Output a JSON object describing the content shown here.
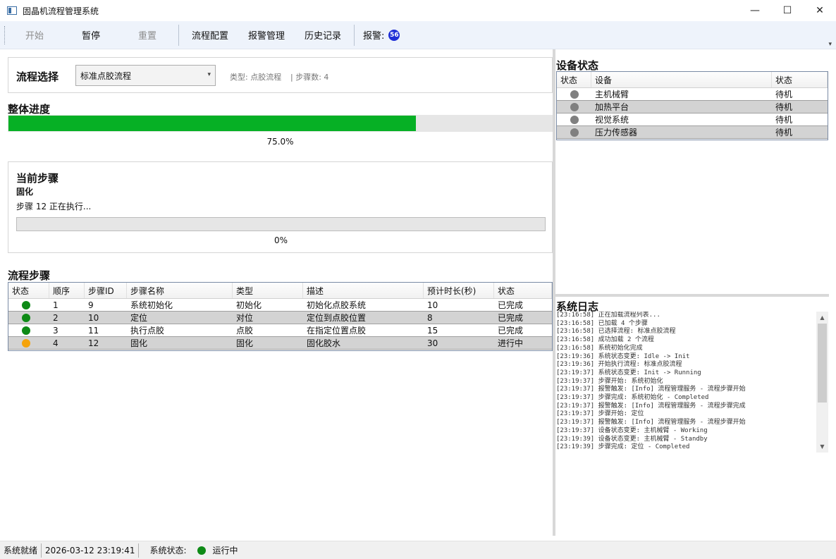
{
  "window": {
    "title": "固晶机流程管理系统",
    "controls": {
      "minimize": "—",
      "maximize": "☐",
      "close": "✕"
    }
  },
  "toolbar": {
    "start_label": "开始",
    "pause_label": "暂停",
    "reset_label": "重置",
    "config_label": "流程配置",
    "alarm_mgmt_label": "报警管理",
    "history_label": "历史记录",
    "alarm_label": "报警:",
    "alarm_count": "56",
    "overflow": "▾"
  },
  "flow_select": {
    "title": "流程选择",
    "selected": "标准点胶流程",
    "type_text": "类型: 点胶流程",
    "steps_text": "| 步骤数: 4"
  },
  "overall": {
    "title": "整体进度",
    "progress_percent": 75.0,
    "progress_text": "75.0%"
  },
  "current_step": {
    "title": "当前步骤",
    "name": "固化",
    "status": "步骤 12 正在执行...",
    "progress_percent": 0,
    "progress_text": "0%"
  },
  "flow_steps": {
    "title": "流程步骤",
    "headers": [
      "状态",
      "顺序",
      "步骤ID",
      "步骤名称",
      "类型",
      "描述",
      "预计时长(秒)",
      "状态"
    ],
    "rows": [
      {
        "order": "1",
        "id": "9",
        "name": "系统初始化",
        "type": "初始化",
        "desc": "初始化点胶系统",
        "duration": "10",
        "status": "已完成",
        "color": "#0e8a16"
      },
      {
        "order": "2",
        "id": "10",
        "name": "定位",
        "type": "对位",
        "desc": "定位到点胶位置",
        "duration": "8",
        "status": "已完成",
        "color": "#0e8a16"
      },
      {
        "order": "3",
        "id": "11",
        "name": "执行点胶",
        "type": "点胶",
        "desc": "在指定位置点胶",
        "duration": "15",
        "status": "已完成",
        "color": "#0e8a16"
      },
      {
        "order": "4",
        "id": "12",
        "name": "固化",
        "type": "固化",
        "desc": "固化胶水",
        "duration": "30",
        "status": "进行中",
        "color": "#f5a30a"
      }
    ]
  },
  "devices": {
    "title": "设备状态",
    "headers": [
      "状态",
      "设备",
      "状态"
    ],
    "rows": [
      {
        "name": "主机械臂",
        "status": "待机",
        "color": "#808080"
      },
      {
        "name": "加热平台",
        "status": "待机",
        "color": "#808080"
      },
      {
        "name": "视觉系统",
        "status": "待机",
        "color": "#808080"
      },
      {
        "name": "压力传感器",
        "status": "待机",
        "color": "#808080"
      }
    ]
  },
  "log": {
    "title": "系统日志",
    "lines": [
      "[23:16:58] 正在加载流程列表...",
      "[23:16:58] 已加载 4 个步骤",
      "[23:16:58] 已选择流程: 标准点胶流程",
      "[23:16:58] 成功加载 2 个流程",
      "[23:16:58] 系统初始化完成",
      "[23:19:36] 系统状态变更: Idle -> Init",
      "[23:19:36] 开始执行流程: 标准点胶流程",
      "[23:19:37] 系统状态变更: Init -> Running",
      "[23:19:37] 步骤开始: 系统初始化",
      "[23:19:37] 报警触发: [Info] 流程管理服务 - 流程步骤开始",
      "[23:19:37] 步骤完成: 系统初始化 - Completed",
      "[23:19:37] 报警触发: [Info] 流程管理服务 - 流程步骤完成",
      "[23:19:37] 步骤开始: 定位",
      "[23:19:37] 报警触发: [Info] 流程管理服务 - 流程步骤开始",
      "[23:19:37] 设备状态变更: 主机械臂 - Working",
      "[23:19:39] 设备状态变更: 主机械臂 - Standby",
      "[23:19:39] 步骤完成: 定位 - Completed"
    ]
  },
  "statusbar": {
    "ready": "系统就绪",
    "datetime": "2026-03-12 23:19:41",
    "state_label": "系统状态:",
    "state_value": "运行中",
    "state_color": "#0e8a16"
  }
}
